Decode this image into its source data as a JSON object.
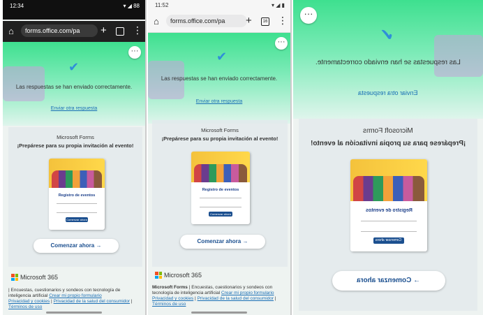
{
  "browser": {
    "url": "forms.office.com/pa",
    "tab_count": "16",
    "p1_time": "12:34",
    "p1_battery": "88",
    "p2_time": "11:52"
  },
  "form": {
    "success_message": "Las respuestas se han enviado correctamente.",
    "send_another": "Enviar otra respuesta",
    "brand": "Microsoft Forms",
    "invite_title": "¡Prepárese para su propia invitación al evento!",
    "flyer_title": "Registro de eventos",
    "flyer_cta": "Comenzar ahora",
    "start_button": "Comenzar ahora"
  },
  "footer": {
    "ms365": "Microsoft 365",
    "brand_bold": "Microsoft Forms",
    "description": "| Encuestas, cuestionarios y sondeos con tecnología de inteligencia artificial",
    "create_link": "Crear mi propio formulario",
    "privacy": "Privacidad y cookies",
    "health_privacy": "Privacidad de la salud del consumidor",
    "terms": "Términos de uso"
  },
  "colors": {
    "green": "#3ee08f",
    "link": "#1a6fb5",
    "button_text": "#1b4f8f"
  }
}
